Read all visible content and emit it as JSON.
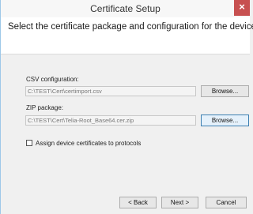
{
  "window": {
    "title": "Certificate Setup",
    "close_glyph": "×"
  },
  "header": {
    "text": "Select the certificate package and configuration for the device"
  },
  "csv": {
    "label": "CSV configuration:",
    "value": "C:\\TEST\\Cert\\certimport.csv",
    "browse_label": "Browse..."
  },
  "zip": {
    "label": "ZIP package:",
    "value": "C:\\TEST\\Cert\\Telia-Root_Base64.cer.zip",
    "browse_label": "Browse..."
  },
  "assign": {
    "label": "Assign device certificates to protocols",
    "checked": false
  },
  "footer": {
    "back_label": "< Back",
    "next_label": "Next >",
    "cancel_label": "Cancel"
  },
  "colors": {
    "close_button": "#c75050",
    "header_bg": "#ffffff",
    "dialog_bg": "#f0f0f0",
    "focus_border": "#3c7fb1"
  }
}
